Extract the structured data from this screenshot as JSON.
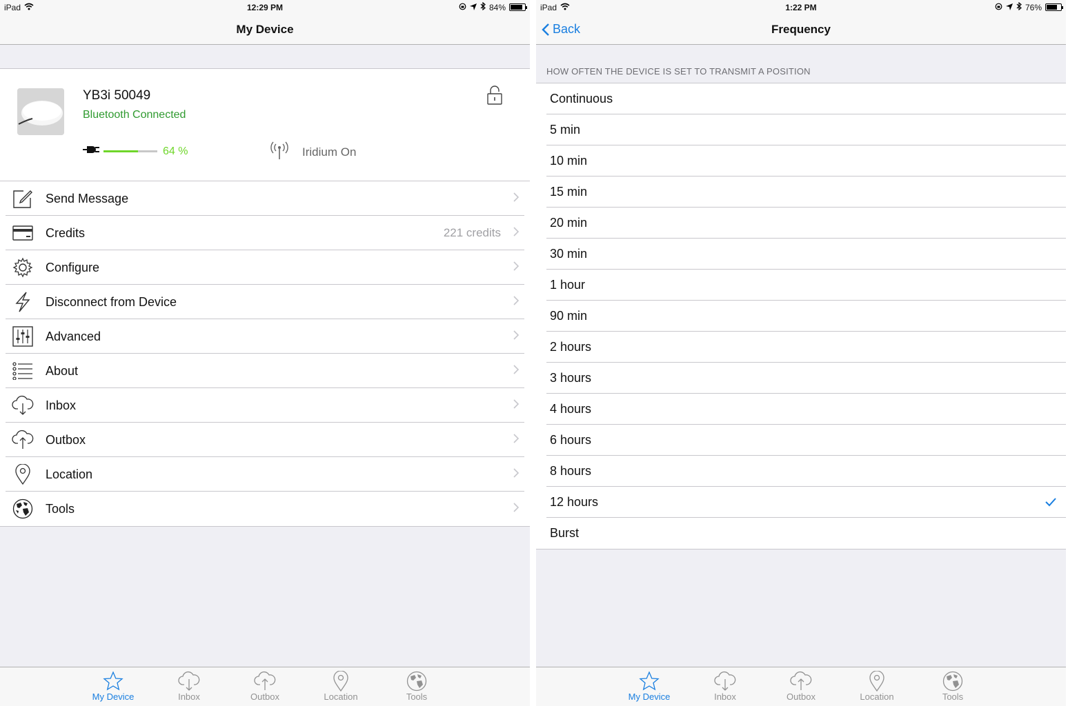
{
  "left": {
    "status": {
      "device": "iPad",
      "time": "12:29 PM",
      "battery": "84%",
      "battery_level": 0.84
    },
    "nav": {
      "title": "My Device"
    },
    "device": {
      "name": "YB3i 50049",
      "connection": "Bluetooth Connected",
      "battery_text": "64 %",
      "battery_level": 0.64,
      "iridium": "Iridium On"
    },
    "menu": [
      {
        "label": "Send Message",
        "detail": "",
        "icon": "compose-icon"
      },
      {
        "label": "Credits",
        "detail": "221 credits",
        "icon": "credit-card-icon"
      },
      {
        "label": "Configure",
        "detail": "",
        "icon": "gear-icon"
      },
      {
        "label": "Disconnect from Device",
        "detail": "",
        "icon": "lightning-icon"
      },
      {
        "label": "Advanced",
        "detail": "",
        "icon": "sliders-icon"
      },
      {
        "label": "About",
        "detail": "",
        "icon": "list-icon"
      },
      {
        "label": "Inbox",
        "detail": "",
        "icon": "cloud-download-icon"
      },
      {
        "label": "Outbox",
        "detail": "",
        "icon": "cloud-upload-icon"
      },
      {
        "label": "Location",
        "detail": "",
        "icon": "location-pin-icon"
      },
      {
        "label": "Tools",
        "detail": "",
        "icon": "globe-icon"
      }
    ],
    "tabs": [
      "My Device",
      "Inbox",
      "Outbox",
      "Location",
      "Tools"
    ],
    "active_tab": "My Device"
  },
  "right": {
    "status": {
      "device": "iPad",
      "time": "1:22 PM",
      "battery": "76%",
      "battery_level": 0.76
    },
    "nav": {
      "title": "Frequency",
      "back": "Back"
    },
    "section_header": "HOW OFTEN THE DEVICE IS SET TO TRANSMIT A POSITION",
    "options": [
      "Continuous",
      "5 min",
      "10 min",
      "15 min",
      "20 min",
      "30 min",
      "1 hour",
      "90 min",
      "2 hours",
      "3 hours",
      "4 hours",
      "6 hours",
      "8 hours",
      "12 hours",
      "Burst"
    ],
    "selected": "12 hours",
    "tabs": [
      "My Device",
      "Inbox",
      "Outbox",
      "Location",
      "Tools"
    ],
    "active_tab": "My Device"
  },
  "colors": {
    "accent": "#1a7fe0",
    "connected": "#2f9a2f",
    "battery": "#6fd62a"
  }
}
